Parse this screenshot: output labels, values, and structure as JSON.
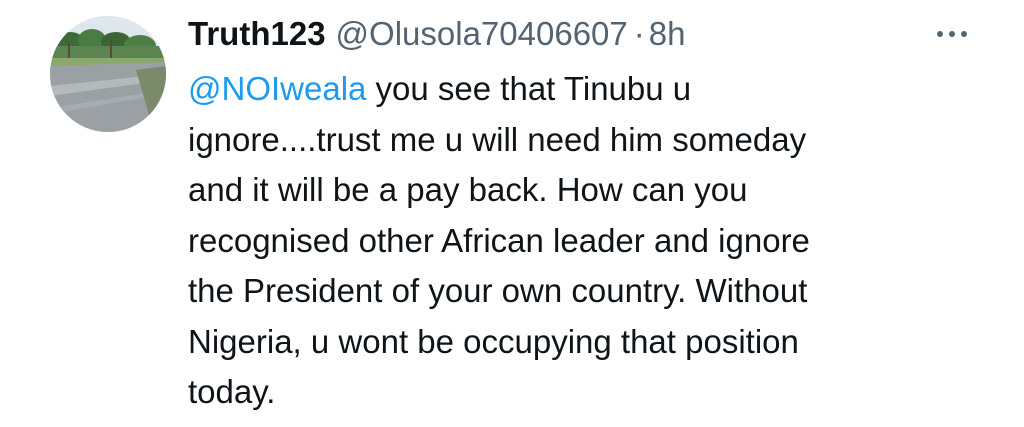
{
  "tweet": {
    "display_name": "Truth123",
    "handle": "@Olusola70406607",
    "separator": "·",
    "time": "8h",
    "more_icon": "more-horizontal-icon",
    "mention": "@NOIweala",
    "lines": [
      " you see that Tinubu u",
      "ignore....trust me u will need him someday",
      "and it will be a pay back. How can you",
      "recognised other African leader and ignore",
      "the President of your own country. Without",
      "Nigeria, u wont be occupying that position",
      "today."
    ]
  },
  "colors": {
    "text": "#0f1419",
    "secondary": "#536471",
    "link": "#1d9bf0"
  }
}
